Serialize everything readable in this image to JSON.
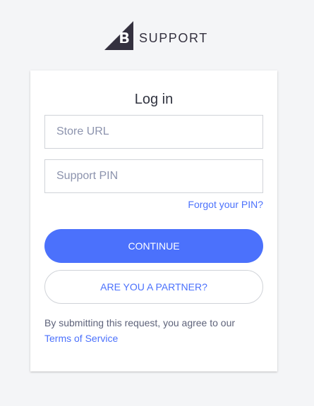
{
  "header": {
    "logo_icon": "bigcommerce-b-logo-icon",
    "brand_text": "SUPPORT"
  },
  "login": {
    "title": "Log in",
    "store_url_placeholder": "Store URL",
    "support_pin_placeholder": "Support PIN",
    "forgot_pin_label": "Forgot your PIN?",
    "continue_label": "CONTINUE",
    "partner_label": "ARE YOU A PARTNER?",
    "disclaimer_text": "By submitting this request, you agree to our",
    "terms_label": "Terms of Service"
  },
  "colors": {
    "accent": "#4b71fc",
    "background": "#f4f5f7",
    "text": "#313440",
    "muted_text": "#5e637a",
    "logo": "#34313f"
  }
}
